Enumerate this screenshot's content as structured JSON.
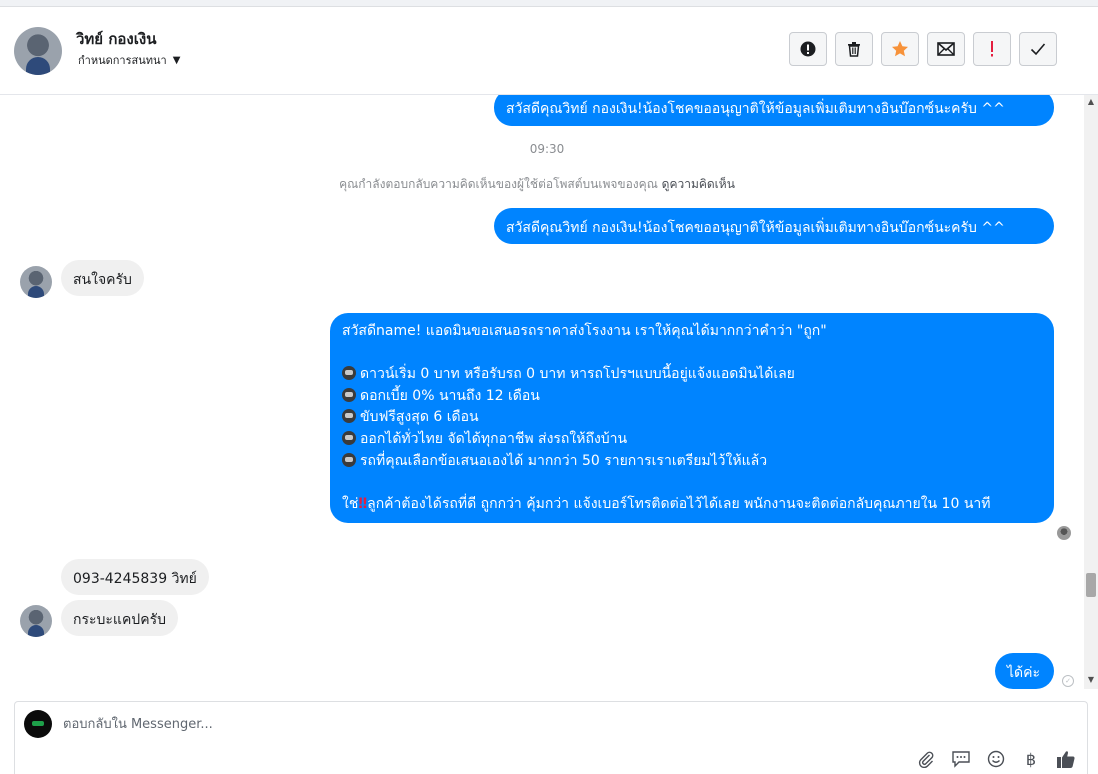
{
  "header": {
    "contact_name": "วิทย์ กองเงิน",
    "assign_label": "กำหนดการสนทนา",
    "actions": [
      {
        "name": "spam-button",
        "icon": "alert-circle-icon"
      },
      {
        "name": "delete-button",
        "icon": "trash-icon"
      },
      {
        "name": "star-button",
        "icon": "star-icon"
      },
      {
        "name": "mark-unread-button",
        "icon": "envelope-icon"
      },
      {
        "name": "important-button",
        "icon": "exclamation-icon"
      },
      {
        "name": "done-button",
        "icon": "checkmark-icon"
      }
    ]
  },
  "messages": {
    "out_1": "สวัสดีคุณวิทย์ กองเงิน!น้องโชคขออนุญาติให้ข้อมูลเพิ่มเติมทางอินบ๊อกซ์นะครับ ^^",
    "time": "09:30",
    "notice_text": "คุณกำลังตอบกลับความคิดเห็นของผู้ใช้ต่อโพสต์บนเพจของคุณ",
    "notice_link": "ดูความคิดเห็น",
    "out_2": "สวัสดีคุณวิทย์ กองเงิน!น้องโชคขออนุญาติให้ข้อมูลเพิ่มเติมทางอินบ๊อกซ์นะครับ ^^",
    "in_1": "สนใจครับ",
    "long": {
      "line1": "สวัสดีname! แอดมินขอเสนอรถราคาส่งโรงงาน เราให้คุณได้มากกว่าคำว่า \"ถูก\"",
      "bullets": [
        "ดาวน์เริ่ม 0 บาท หรือรับรถ 0 บาท หารถโปรฯแบบนี้อยู่แจ้งแอดมินได้เลย",
        "ดอกเบี้ย 0% นานถึง 12 เดือน",
        "ขับฟรีสูงสุด 6 เดือน",
        "ออกได้ทั่วไทย จัดได้ทุกอาชีพ ส่งรถให้ถึงบ้าน",
        "รถที่คุณเลือกข้อเสนอเองได้ มากกว่า 50 รายการเราเตรียมไว้ให้แล้ว"
      ],
      "closing_prefix": "ใช่",
      "closing_mark": "‼",
      "closing_rest": "ลูกค้าต้องได้รถที่ดี ถูกกว่า คุ้มกว่า แจ้งเบอร์โทรติดต่อไว้ได้เลย พนักงานจะติดต่อกลับคุณภายใน 10 นาที"
    },
    "in_2": "093-4245839 วิทย์",
    "in_3": "กระบะแคปครับ",
    "out_3": "ได้ค่ะ"
  },
  "composer": {
    "placeholder": "ตอบกลับใน Messenger...",
    "tools": [
      "paperclip-icon",
      "saved-reply-icon",
      "emoji-icon",
      "baht-icon",
      "thumbs-up-icon"
    ],
    "baht_symbol": "฿"
  },
  "colors": {
    "outgoing_bubble": "#0084ff",
    "incoming_bubble": "#f0f0f0",
    "star": "#f7923a",
    "important": "#e41e3f"
  }
}
